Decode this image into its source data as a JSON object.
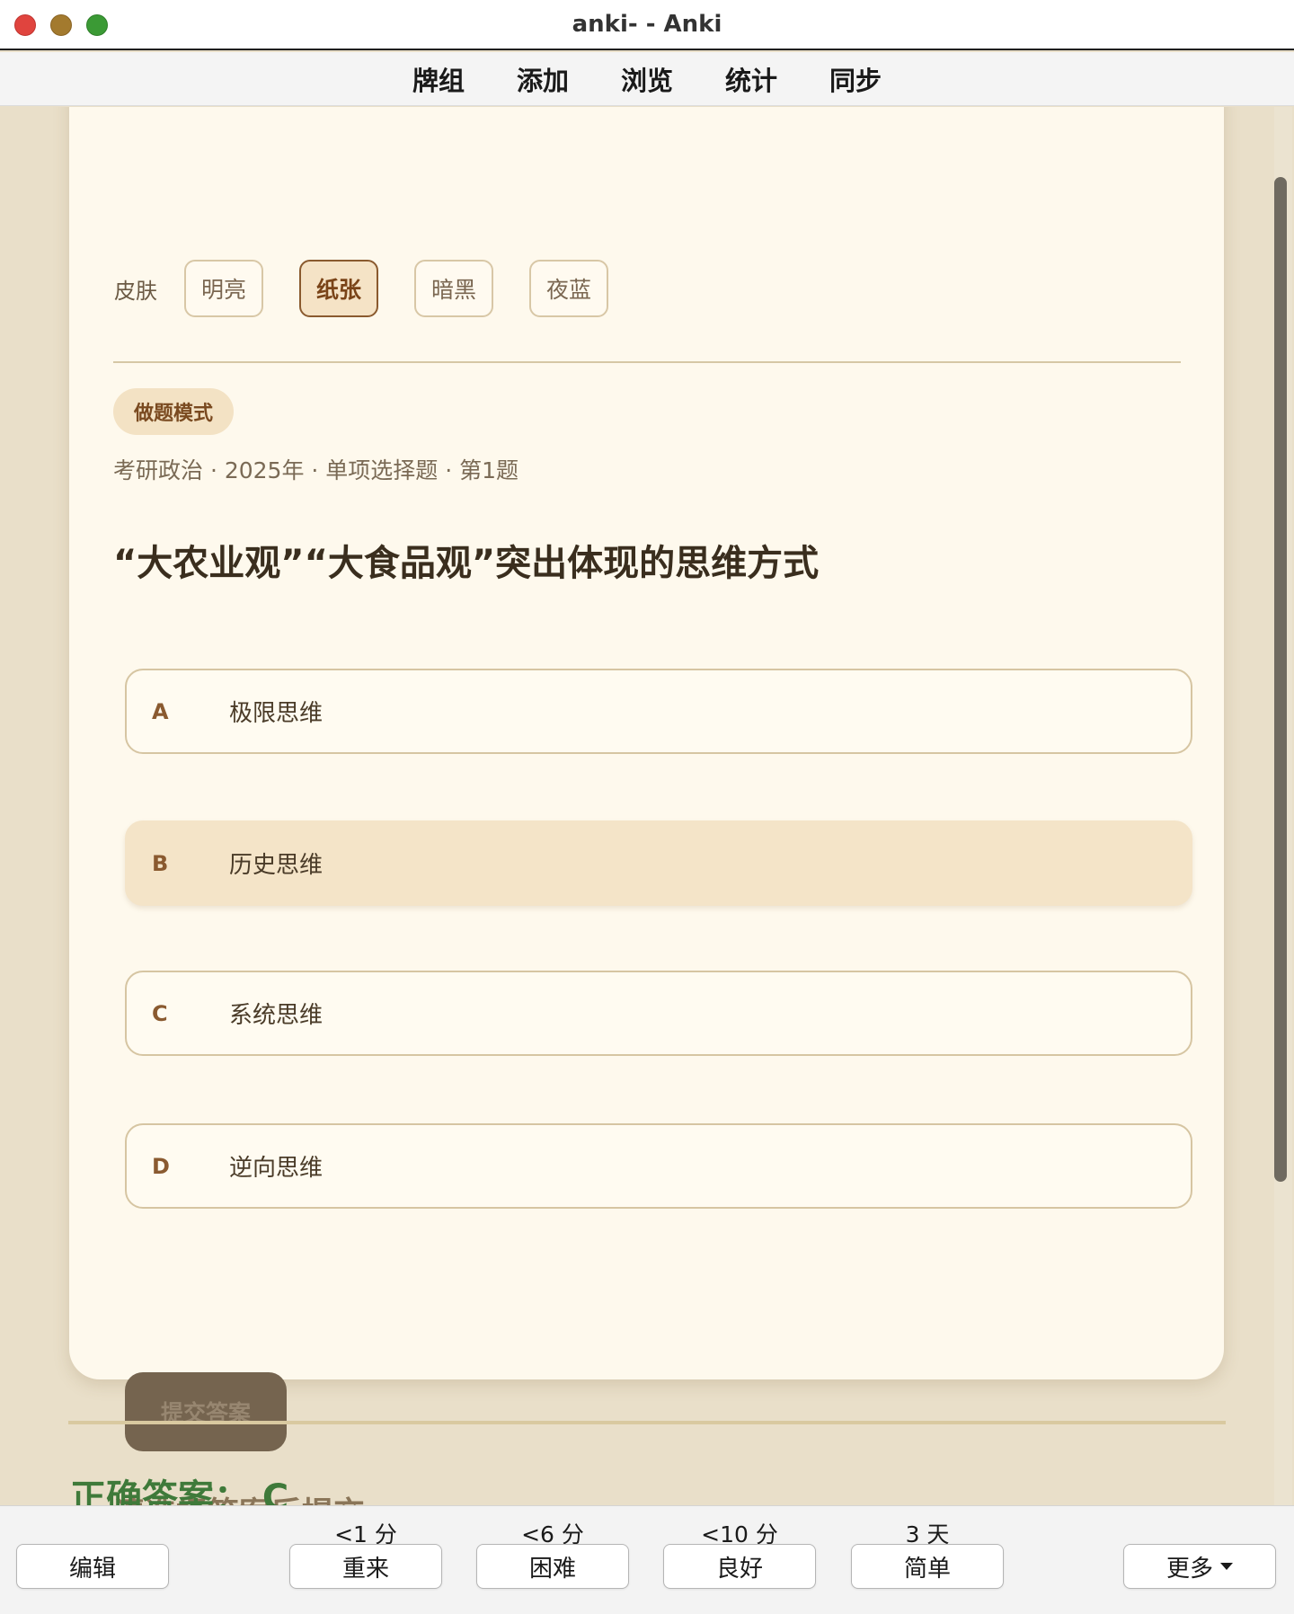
{
  "window": {
    "title": "anki- - Anki"
  },
  "menu": {
    "items": [
      "牌组",
      "添加",
      "浏览",
      "统计",
      "同步"
    ]
  },
  "skin": {
    "label": "皮肤",
    "options": [
      "明亮",
      "纸张",
      "暗黑",
      "夜蓝"
    ],
    "selected": "纸张"
  },
  "card": {
    "mode": "做题模式",
    "meta": "考研政治 · 2025年 · 单项选择题 · 第1题",
    "question": "“大农业观”“大食品观”突出体现的思维方式",
    "options": [
      {
        "letter": "A",
        "text": "极限思维"
      },
      {
        "letter": "B",
        "text": "历史思维"
      },
      {
        "letter": "C",
        "text": "系统思维"
      },
      {
        "letter": "D",
        "text": "逆向思维"
      }
    ],
    "selected_option": "B",
    "submit_label": "提交答案",
    "hint": "请选择答案后提交",
    "answer": "正确答案：  C"
  },
  "bottom": {
    "edit": "编辑",
    "more": "更多",
    "answers": [
      {
        "time": "<1 分",
        "label": "重来"
      },
      {
        "time": "<6 分",
        "label": "困难"
      },
      {
        "time": "<10 分",
        "label": "良好"
      },
      {
        "time": "3 天",
        "label": "简单"
      }
    ]
  },
  "colors": {
    "accent": "#8a5a2e",
    "answer_green": "#3f7a3a",
    "page_bg": "#e9dfc9",
    "card_bg": "#fef9ed"
  }
}
